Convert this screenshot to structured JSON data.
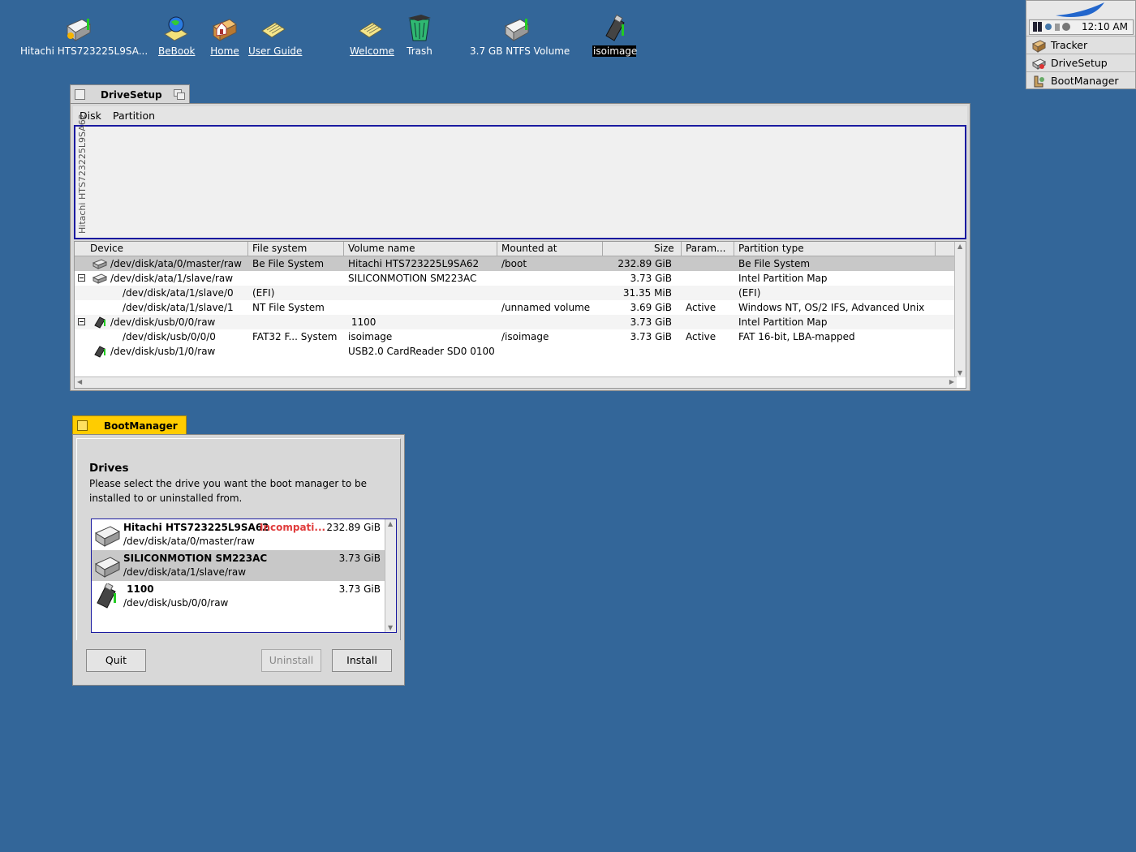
{
  "desktop": {
    "icons": [
      {
        "name": "Hitachi HTS723225L9SA..."
      },
      {
        "name": "BeBook"
      },
      {
        "name": "Home"
      },
      {
        "name": "User Guide"
      },
      {
        "name": "Welcome"
      },
      {
        "name": "Trash"
      },
      {
        "name": "3.7 GB NTFS Volume"
      },
      {
        "name": "isoimage"
      }
    ]
  },
  "deskbar": {
    "clock": "12:10 AM",
    "apps": [
      "Tracker",
      "DriveSetup",
      "BootManager"
    ]
  },
  "drivesetup": {
    "title": "DriveSetup",
    "menu": [
      "Disk",
      "Partition"
    ],
    "map_label": "Hitachi HTS723225L9SA62",
    "columns": [
      "Device",
      "File system",
      "Volume name",
      "Mounted at",
      "Size",
      "Param...",
      "Partition type"
    ],
    "rows": [
      {
        "device": "/dev/disk/ata/0/master/raw",
        "fs": "Be File System",
        "volume": "Hitachi HTS723225L9SA62",
        "mounted": "/boot",
        "size": "232.89 GiB",
        "param": "",
        "ptype": "Be File System"
      },
      {
        "device": "/dev/disk/ata/1/slave/raw",
        "fs": "",
        "volume": "SILICONMOTION SM223AC",
        "mounted": "",
        "size": "3.73 GiB",
        "param": "",
        "ptype": "Intel Partition Map"
      },
      {
        "device": "/dev/disk/ata/1/slave/0",
        "fs": "(EFI)",
        "volume": "",
        "mounted": "",
        "size": "31.35 MiB",
        "param": "",
        "ptype": "(EFI)"
      },
      {
        "device": "/dev/disk/ata/1/slave/1",
        "fs": "NT File System",
        "volume": "",
        "mounted": "/unnamed volume",
        "size": "3.69 GiB",
        "param": "Active",
        "ptype": "Windows NT, OS/2 IFS, Advanced Unix"
      },
      {
        "device": "/dev/disk/usb/0/0/raw",
        "fs": "",
        "volume": " 1100",
        "mounted": "",
        "size": "3.73 GiB",
        "param": "",
        "ptype": "Intel Partition Map"
      },
      {
        "device": "/dev/disk/usb/0/0/0",
        "fs": "FAT32 F... System",
        "volume": "isoimage",
        "mounted": "/isoimage",
        "size": "3.73 GiB",
        "param": "Active",
        "ptype": "FAT 16-bit, LBA-mapped"
      },
      {
        "device": "/dev/disk/usb/1/0/raw",
        "fs": "",
        "volume": "USB2.0 CardReader SD0 0100",
        "mounted": "",
        "size": "",
        "param": "",
        "ptype": ""
      }
    ]
  },
  "bootmanager": {
    "title": "BootManager",
    "heading": "Drives",
    "description": "Please select the drive you want the boot manager to be installed to or uninstalled from.",
    "drives": [
      {
        "name": "Hitachi HTS723225L9SA62",
        "warning": "Incompati...",
        "size": "232.89 GiB",
        "path": "/dev/disk/ata/0/master/raw"
      },
      {
        "name": "SILICONMOTION SM223AC",
        "warning": "",
        "size": "3.73 GiB",
        "path": "/dev/disk/ata/1/slave/raw"
      },
      {
        "name": " 1100",
        "warning": "",
        "size": "3.73 GiB",
        "path": "/dev/disk/usb/0/0/raw"
      }
    ],
    "buttons": {
      "quit": "Quit",
      "uninstall": "Uninstall",
      "install": "Install"
    }
  }
}
